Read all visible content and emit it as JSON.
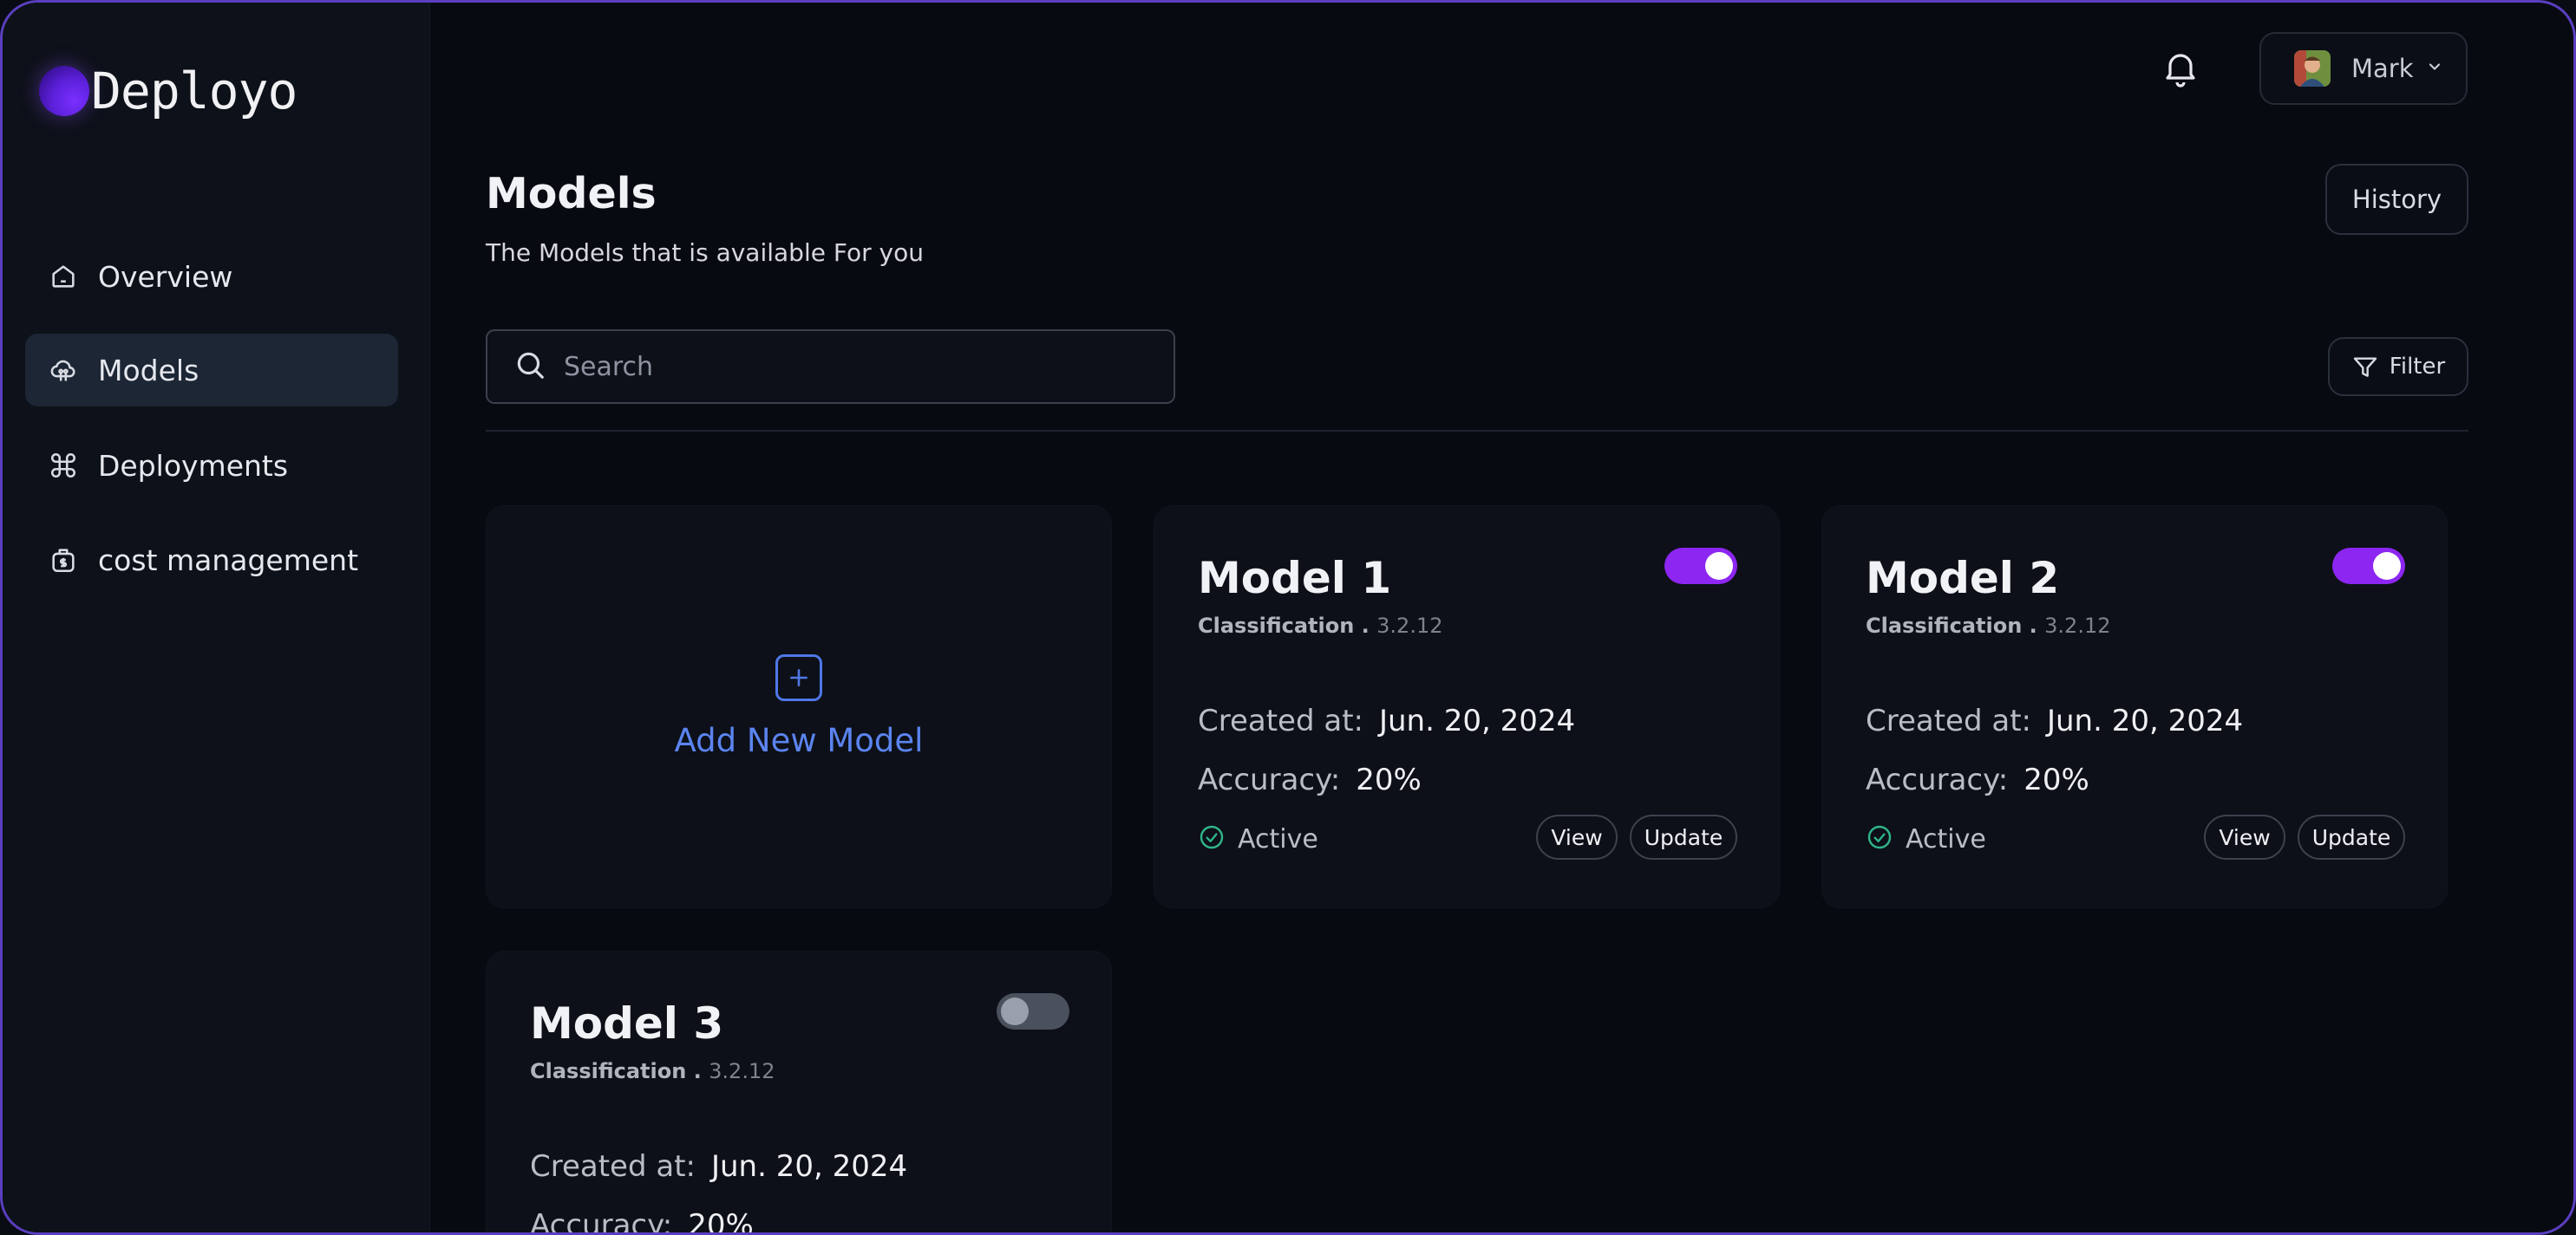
{
  "app": {
    "name": "Deployo"
  },
  "sidebar": {
    "items": [
      {
        "label": "Overview",
        "icon": "home-icon",
        "active": false
      },
      {
        "label": "Models",
        "icon": "cloud-brain-icon",
        "active": true
      },
      {
        "label": "Deployments",
        "icon": "command-icon",
        "active": false
      },
      {
        "label": "cost management",
        "icon": "money-bag-icon",
        "active": false
      }
    ]
  },
  "topbar": {
    "user_name": "Mark",
    "bell_icon": "bell-icon"
  },
  "page": {
    "title": "Models",
    "subtitle": "The Models that is available For you",
    "history_label": "History",
    "filter_label": "Filter",
    "search_placeholder": "Search"
  },
  "add_card": {
    "label": "Add New Model"
  },
  "models": [
    {
      "name": "Model 1",
      "type": "Classification .",
      "version": "3.2.12",
      "created_label": "Created at:",
      "created": "Jun. 20, 2024",
      "accuracy_label": "Accuracy:",
      "accuracy": "20%",
      "status": "Active",
      "enabled": true,
      "view_label": "View",
      "update_label": "Update"
    },
    {
      "name": "Model 2",
      "type": "Classification .",
      "version": "3.2.12",
      "created_label": "Created at:",
      "created": "Jun. 20, 2024",
      "accuracy_label": "Accuracy:",
      "accuracy": "20%",
      "status": "Active",
      "enabled": true,
      "view_label": "View",
      "update_label": "Update"
    },
    {
      "name": "Model 3",
      "type": "Classification .",
      "version": "3.2.12",
      "created_label": "Created at:",
      "created": "Jun. 20, 2024",
      "accuracy_label": "Accuracy:",
      "accuracy": "20%",
      "enabled": false
    }
  ],
  "colors": {
    "accent": "#8c26f0",
    "link": "#5b84f0",
    "active_status": "#2fb58a"
  }
}
